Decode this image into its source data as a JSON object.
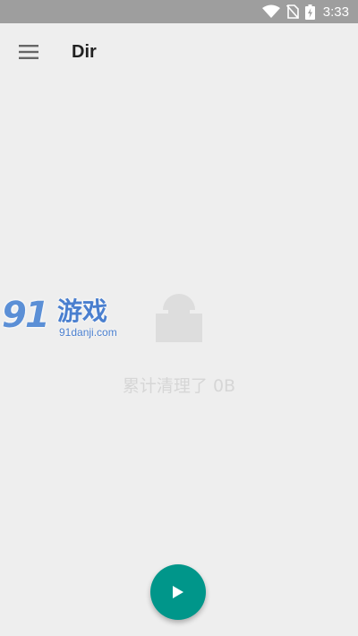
{
  "status_bar": {
    "time": "3:33",
    "icons": [
      "wifi-icon",
      "no-sim-icon",
      "battery-charging-icon"
    ],
    "background": "#9e9e9e"
  },
  "app_bar": {
    "title": "Dir",
    "menu_icon": "hamburger-menu-icon"
  },
  "main": {
    "illustration_icon": "lock-icon",
    "cleaned_text": "累计清理了 0B"
  },
  "watermark": {
    "logo_text": "91",
    "name": "游戏",
    "url": "91danji.com"
  },
  "fab": {
    "icon": "play-icon",
    "color": "#00968a"
  }
}
